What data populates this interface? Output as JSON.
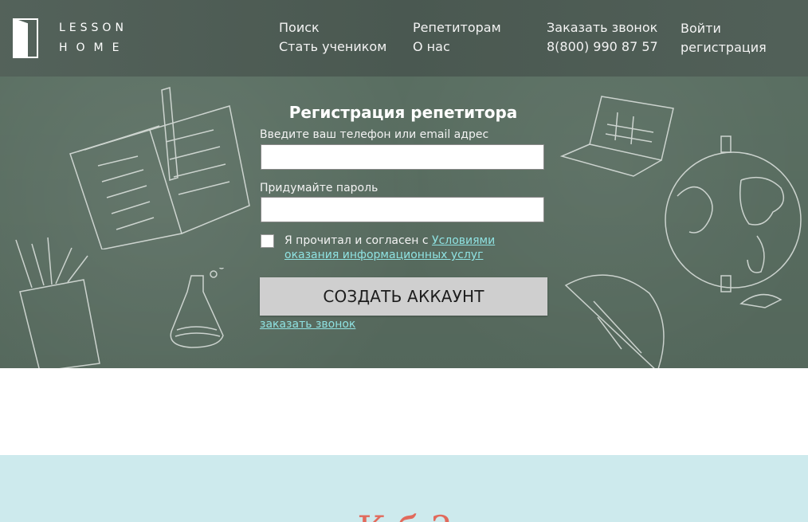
{
  "header": {
    "logo": {
      "line1": "LESSON",
      "line2": "HOME"
    },
    "nav": {
      "search": "Поиск",
      "become_student": "Стать учеником",
      "for_tutors": "Репетиторам",
      "about": "О нас",
      "order_call": "Заказать звонок",
      "phone": "8(800) 990 87 57",
      "login": "Войти",
      "register": "регистрация"
    }
  },
  "form": {
    "title": "Регистрация репетитора",
    "contact_label": "Введите ваш телефон или email адрес",
    "password_label": "Придумайте пароль",
    "contact_value": "",
    "password_value": "",
    "agree_prefix": "Я прочитал и согласен с ",
    "terms_link": "Условиями оказания информационных услуг",
    "submit_label": "СОЗДАТЬ АККАУНТ",
    "order_call_link": "заказать звонок"
  },
  "next_section": {
    "heading_partial": "К     б   ?"
  },
  "colors": {
    "header_bg": "#4e5d55",
    "hero_bg": "#5b7063",
    "accent_link": "#8fe2e2",
    "button_bg": "#cfcfcf",
    "blue_section": "#cdeaed",
    "heading_red": "#e16a5c"
  }
}
